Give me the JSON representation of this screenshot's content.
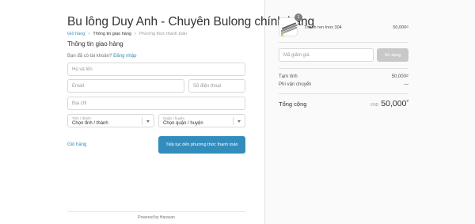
{
  "shop": {
    "title": "Bu lông Duy Anh - Chuyên Bulong chính hãng"
  },
  "breadcrumb": [
    {
      "label": "Giỏ hàng"
    },
    {
      "label": "Thông tin giao hàng"
    },
    {
      "label": "Phương thức thanh toán"
    }
  ],
  "shipping": {
    "section_title": "Thông tin giao hàng",
    "login_prompt": "Bạn đã có tài khoản?",
    "login_link": "Đăng nhập",
    "fullname_placeholder": "Họ và tên",
    "email_placeholder": "Email",
    "phone_placeholder": "Số điện thoại",
    "address_placeholder": "Địa chỉ",
    "province": {
      "label": "Tỉnh / thành",
      "value": "Chọn tỉnh / thành"
    },
    "district": {
      "label": "Quận / huyện",
      "value": "Chọn quận / huyện"
    }
  },
  "actions": {
    "back_label": "Giỏ hàng",
    "continue_label": "Tiếp tục đến phương thức thanh toán"
  },
  "footer": {
    "text": "Powered by Haravan"
  },
  "order": {
    "product": {
      "name": "Thanh ren Inox 304",
      "price": "50,000₫",
      "quantity": "1"
    },
    "discount_placeholder": "Mã giảm giá",
    "discount_button": "Sử dụng",
    "subtotal_label": "Tạm tính",
    "subtotal_value": "50,000₫",
    "shipping_label": "Phí vận chuyển",
    "shipping_value": "—",
    "total_label": "Tổng cộng",
    "total_currency": "VND",
    "total_amount": "50,000",
    "total_symbol": "₫"
  },
  "colors": {
    "accent": "#338dbc",
    "button_disabled": "#c8c8c8",
    "sidebar_bg": "#fafafa"
  }
}
